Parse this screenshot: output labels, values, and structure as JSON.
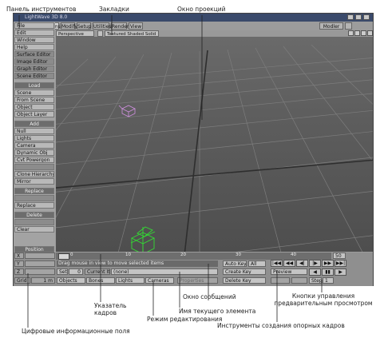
{
  "window": {
    "title": "LightWave 3D 8.0",
    "modeler_button": "Modler"
  },
  "tabs": [
    {
      "label": "Items",
      "active": true
    },
    {
      "label": "Modify",
      "active": false
    },
    {
      "label": "Setup",
      "active": false
    },
    {
      "label": "Utilities",
      "active": false
    },
    {
      "label": "Render",
      "active": false
    },
    {
      "label": "View",
      "active": false
    }
  ],
  "sidebar": {
    "menus": [
      "File",
      "Edit",
      "Window",
      "Help",
      "Surface Editor",
      "Image Editor",
      "Graph Editor",
      "Scene Editor"
    ],
    "load_header": "Load",
    "load_items": [
      "Scene",
      "From Scene",
      "Object",
      "Object Layer"
    ],
    "add_header": "Add",
    "add_items": [
      "Null",
      "Lights",
      "Camera",
      "Dynamic Obj",
      "Cvt Powergon",
      "",
      "Clone Hierarchy",
      "Mirror"
    ],
    "replace_header": "Replace",
    "replace_items": [
      "",
      "Replace"
    ],
    "delete_header": "Delete",
    "delete_items": [
      "",
      "Clear"
    ],
    "position_label": "Position"
  },
  "viewport": {
    "view_mode": "Perspective",
    "render_mode": "Textured Shaded Solid"
  },
  "timeline": {
    "ticks": [
      "0",
      "10",
      "20",
      "30",
      "40",
      "50"
    ],
    "current_frame": "0"
  },
  "bottom": {
    "message": "Drag mouse in view to move selected items",
    "current_item_label": "Current Item",
    "current_item_value": "(none)",
    "left_fields": [
      "X",
      "Y",
      "Z",
      "Grid"
    ],
    "grid_value": "1 m",
    "set_label": "Set",
    "set_value": "0",
    "objects_label": "Objects",
    "bones_label": "Bones",
    "lights_label": "Lights",
    "cameras_label": "Cameras",
    "properties_label": "Properties",
    "autokey_label": "Auto Key",
    "autokey_value": "All",
    "create_key": "Create Key",
    "delete_key": "Delete Key",
    "preview_label": "Preview",
    "step_label": "Step",
    "step_value": "1"
  },
  "annotations": {
    "toolbar_panel": "Панель инструментов",
    "tabs": "Закладки",
    "viewport": "Окно проекций",
    "messages_window": "Окно сообщений",
    "preview_buttons": "Кнопки управления предварительным просмотром",
    "frame_pointer": "Указатель кадров",
    "edit_mode": "Режим редактирования",
    "current_element": "Имя текущего элемента",
    "numeric_fields": "Цифровые информационные поля",
    "keyframe_tools": "Инструменты создания опорных кадров"
  }
}
